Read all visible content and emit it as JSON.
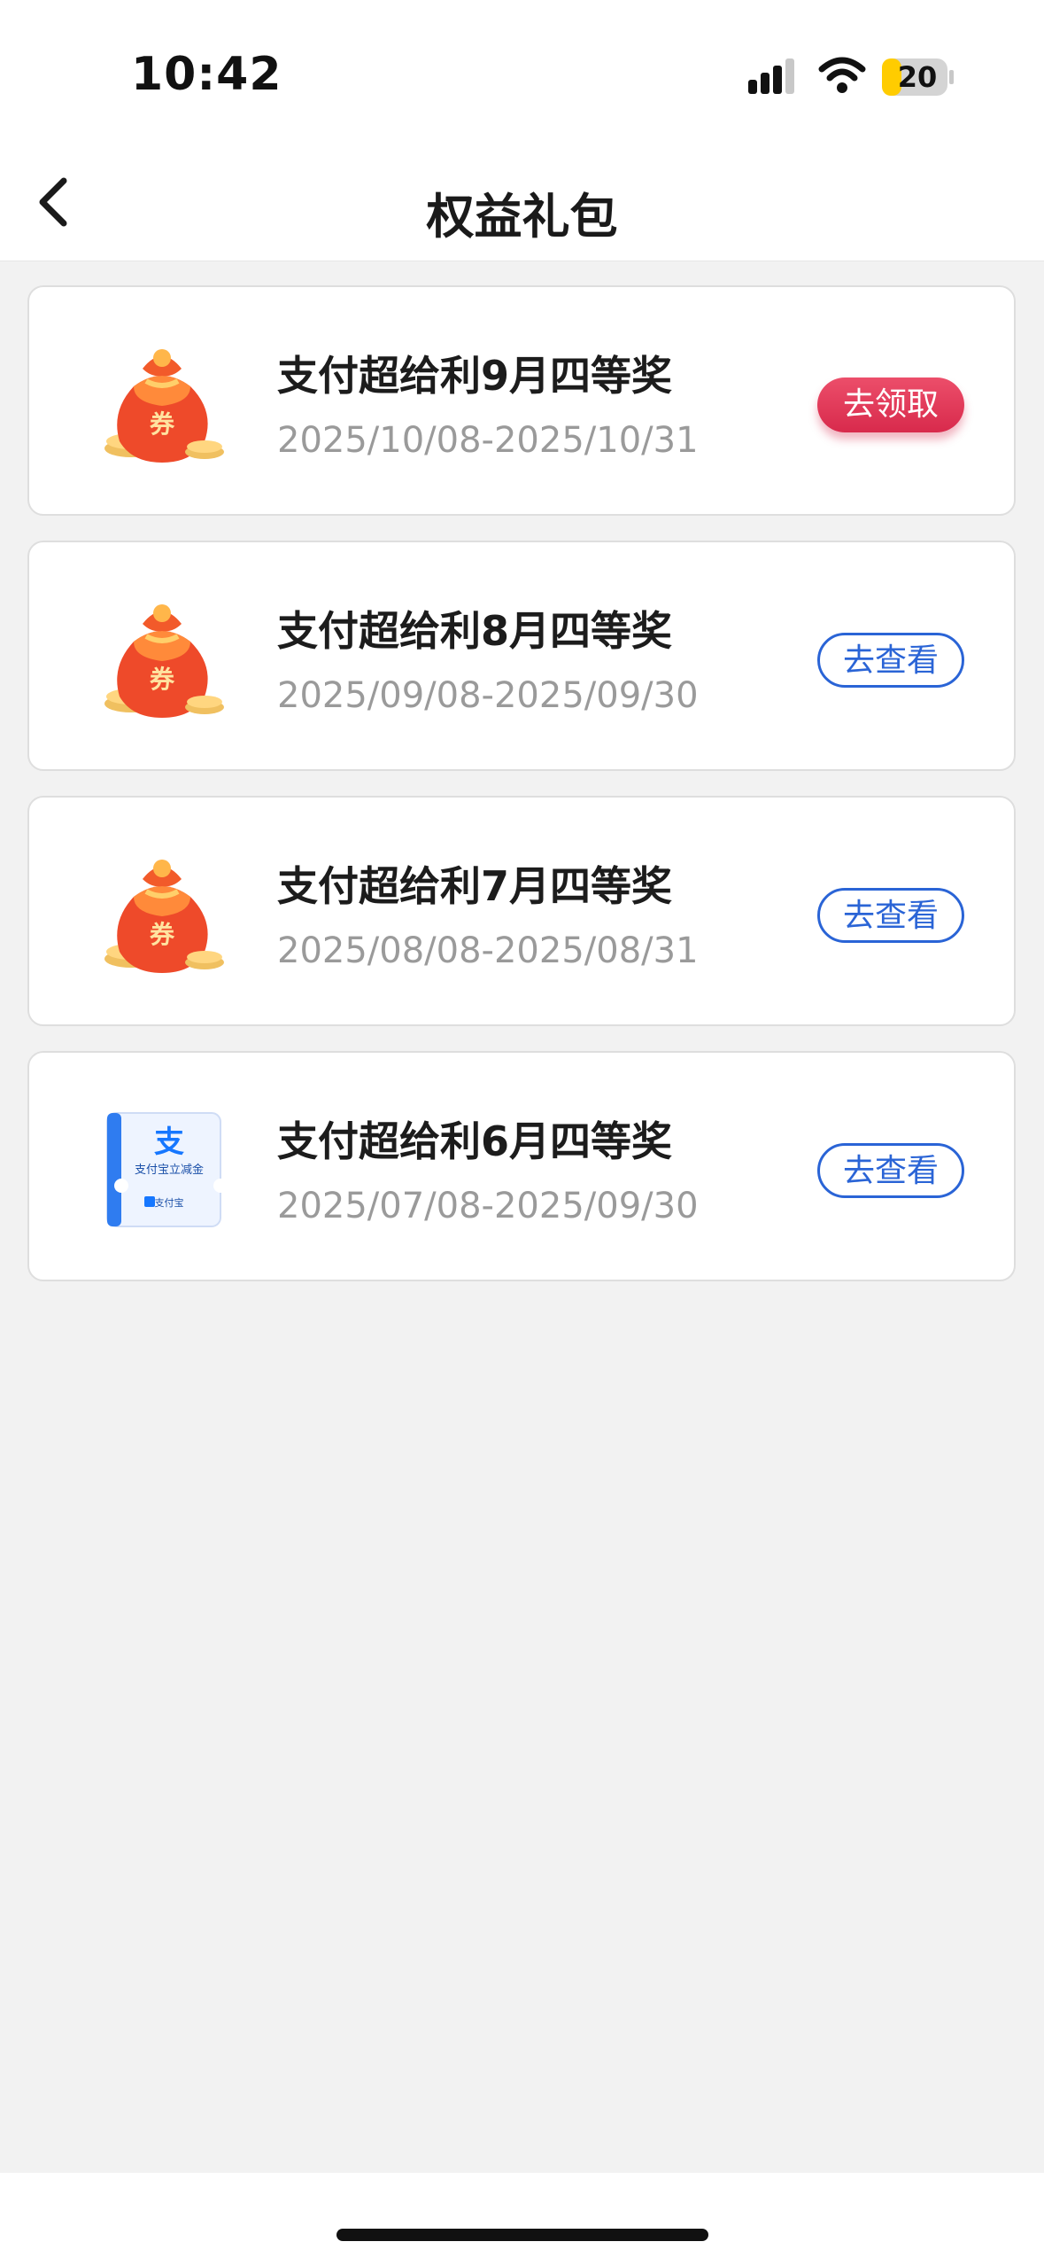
{
  "status_bar": {
    "time": "10:42",
    "battery": "20"
  },
  "header": {
    "title": "权益礼包"
  },
  "items": [
    {
      "name": "支付超给利9月四等奖",
      "date_range": "2025/10/08-2025/10/31",
      "action": "去领取",
      "icon": "red-envelope-coupon-bag-icon"
    },
    {
      "name": "支付超给利8月四等奖",
      "date_range": "2025/09/08-2025/09/30",
      "action": "去查看",
      "icon": "red-envelope-coupon-bag-icon"
    },
    {
      "name": "支付超给利7月四等奖",
      "date_range": "2025/08/08-2025/08/31",
      "action": "去查看",
      "icon": "red-envelope-coupon-bag-icon"
    },
    {
      "name": "支付超给利6月四等奖",
      "date_range": "2025/07/08-2025/09/30",
      "action": "去查看",
      "icon": "alipay-voucher-icon",
      "icon_caption": "支付宝立减金",
      "icon_brand": "支付宝"
    }
  ],
  "colors": {
    "accent_blue": "#2a64d6",
    "claim_red": "#d82a4c",
    "background": "#f2f2f2"
  }
}
